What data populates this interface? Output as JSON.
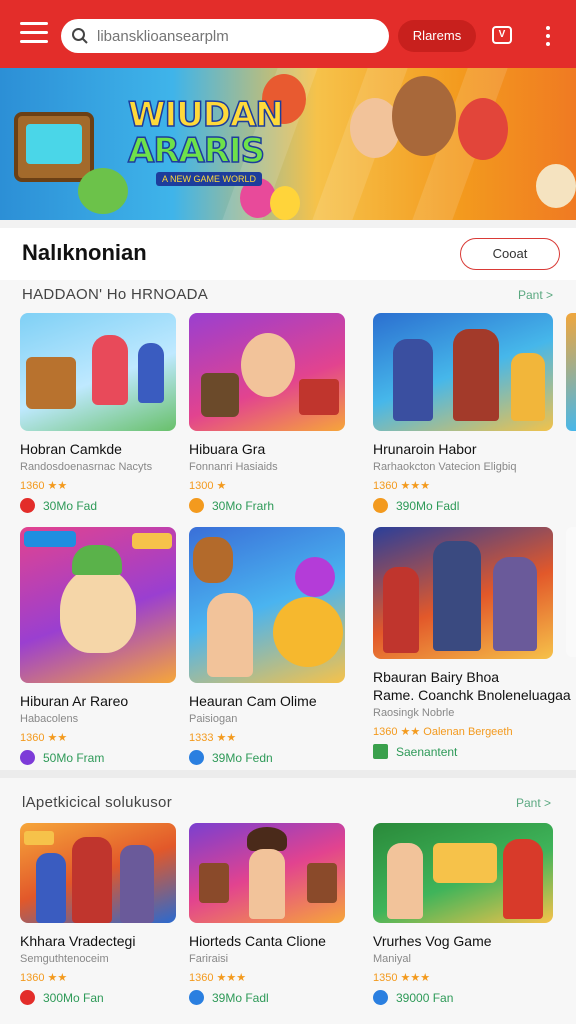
{
  "top_bar": {
    "search_placeholder": "libansklioansearplm",
    "pill_button": "Rlarems",
    "store_badge": "V"
  },
  "banner": {
    "title_line1": "WIUDAN",
    "title_line2": "ARARIS",
    "subtitle": "A NEW GAME WORLD"
  },
  "section": {
    "title": "Nalıknonian",
    "button": "Cooat"
  },
  "block1": {
    "title": "HADDAON' Ho HRNOADA",
    "see_all": "Pant >",
    "cards": [
      {
        "name": "Hobran Camkde",
        "dev": "Randosdoenasrnac Nacyts",
        "rating": "1360 ★★",
        "price": "30Mo Fad",
        "dot": "#e32d2a"
      },
      {
        "name": "Hibuara Gra",
        "dev": "Fonnanri Hasiaids",
        "rating": "1300 ★",
        "price": "30Mo Frarh",
        "dot": "#f39a1e"
      },
      {
        "name": "Hrunaroin Habor",
        "dev": "Rarhaokcton Vatecion Eligbiq",
        "rating": "1360 ★★★",
        "price": "390Mo Fadl",
        "dot": "#f39a1e"
      }
    ]
  },
  "block2": {
    "cards": [
      {
        "name": "Hiburan Ar Rareo",
        "dev": "Habacolens",
        "rating": "1360 ★★",
        "price": "50Mo Fram",
        "dot": "#7d3bd8"
      },
      {
        "name": "Heauran Cam Olime",
        "dev": "Paisiogan",
        "rating": "1333 ★★",
        "price": "39Mo Fedn",
        "dot": "#2a7fe0"
      },
      {
        "name": "Rbauran Bairy Bhoa",
        "name2": "Rame. Coanchk Bnoleneluagaa",
        "dev": "Raosingk Nobrle",
        "rating": "1360 ★★ Oalenan Bergeeth",
        "price": "Saenantent",
        "dot": "#3aa04c"
      }
    ]
  },
  "block3": {
    "title": "lApetkicical solukusor",
    "see_all": "Pant >",
    "cards": [
      {
        "name": "Khhara Vradectegi",
        "dev": "Semguthtenoceim",
        "rating": "1360 ★★",
        "price": "300Mo Fan",
        "dot": "#e32d2a"
      },
      {
        "name": "Hiorteds Canta Clione",
        "dev": "Fariraisi",
        "rating": "1360 ★★★",
        "price": "39Mo Fadl",
        "dot": "#2a7fe0"
      },
      {
        "name": "Vrurhes Vog Game",
        "dev": "Maniyal",
        "rating": "1350 ★★★",
        "price": "39000 Fan",
        "dot": "#2a7fe0"
      }
    ]
  }
}
